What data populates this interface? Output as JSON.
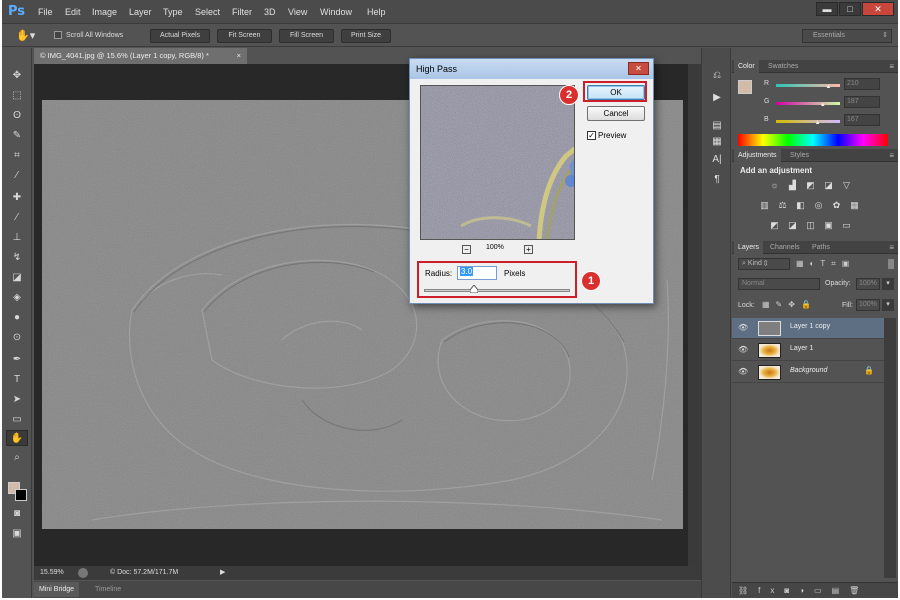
{
  "app": {
    "logo": "Ps"
  },
  "menu": [
    "File",
    "Edit",
    "Image",
    "Layer",
    "Type",
    "Select",
    "Filter",
    "3D",
    "View",
    "Window",
    "Help"
  ],
  "window_controls": {
    "minimize": "▬",
    "maximize": "□",
    "close": "✕"
  },
  "options_bar": {
    "scroll_all_windows": "Scroll All Windows",
    "buttons": [
      "Actual Pixels",
      "Fit Screen",
      "Fill Screen",
      "Print Size"
    ],
    "workspace": "Essentials"
  },
  "document": {
    "tab_title": "© IMG_4041.jpg @ 15.6% (Layer 1 copy, RGB/8) *",
    "zoom": "15.59%",
    "doc_info": "Doc: 57.2M/171.7M"
  },
  "bottom_tabs": [
    "Mini Bridge",
    "Timeline"
  ],
  "color_panel": {
    "tabs": [
      "Color",
      "Swatches"
    ],
    "channels": [
      {
        "label": "R",
        "value": "210",
        "level": 0.82
      },
      {
        "label": "G",
        "value": "187",
        "level": 0.73
      },
      {
        "label": "B",
        "value": "167",
        "level": 0.65
      }
    ],
    "foreground": "#d2bba7",
    "background": "#000000"
  },
  "adjustments_panel": {
    "tabs": [
      "Adjustments",
      "Styles"
    ],
    "heading": "Add an adjustment"
  },
  "layers_panel": {
    "tabs": [
      "Layers",
      "Channels",
      "Paths"
    ],
    "kind": "Kind",
    "blend_mode": "Normal",
    "opacity_label": "Opacity:",
    "opacity": "100%",
    "lock_label": "Lock:",
    "fill_label": "Fill:",
    "fill": "100%",
    "layers": [
      "Layer 1 copy",
      "Layer 1",
      "Background"
    ]
  },
  "dialog": {
    "title": "High Pass",
    "ok": "OK",
    "cancel": "Cancel",
    "preview_label": "Preview",
    "preview_checked": true,
    "zoom": "100%",
    "radius_label": "Radius:",
    "radius_value": "3.0",
    "radius_unit": "Pixels"
  },
  "annotations": [
    "1",
    "2"
  ],
  "colors": {
    "accent": "#cc1f2b",
    "ok_highlight": "#3399ff"
  }
}
